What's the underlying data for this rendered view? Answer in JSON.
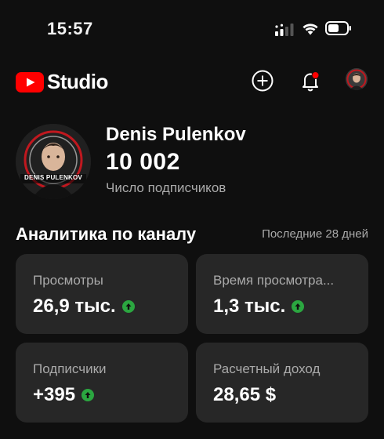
{
  "status_bar": {
    "time": "15:57",
    "icons": [
      "cellular-signal-icon",
      "wifi-icon",
      "battery-icon"
    ]
  },
  "header": {
    "app_name": "Studio",
    "brand_color": "#ff0000",
    "notification_dot_color": "#ff0000",
    "icons": [
      "youtube-logo-icon",
      "create-plus-icon",
      "notifications-bell-icon",
      "account-avatar"
    ]
  },
  "channel": {
    "name": "Denis Pulenkov",
    "avatar_caption": "DENIS PULENKOV",
    "subscriber_count": "10 002",
    "subscriber_label": "Число подписчиков"
  },
  "analytics": {
    "title": "Аналитика по каналу",
    "period": "Последние 28 дней",
    "trend_color": "#2ba640",
    "cards": [
      {
        "label": "Просмотры",
        "value": "26,9 тыс.",
        "trend": "up"
      },
      {
        "label": "Время просмотра...",
        "value": "1,3 тыс.",
        "trend": "up"
      },
      {
        "label": "Подписчики",
        "value": "+395",
        "trend": "up"
      },
      {
        "label": "Расчетный доход",
        "value": "28,65 $",
        "trend": "none"
      }
    ]
  }
}
